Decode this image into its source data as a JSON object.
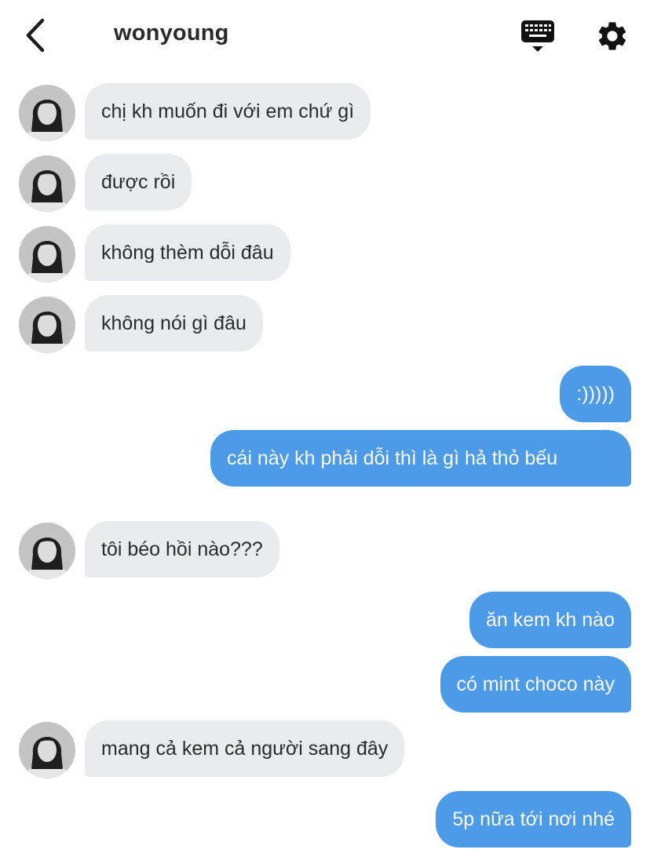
{
  "header": {
    "title": "wonyoung",
    "back_icon": "chevron-left-icon",
    "keyboard_icon": "keyboard-icon",
    "settings_icon": "gear-icon"
  },
  "messages": [
    {
      "direction": "in",
      "text": "chị kh muốn đi với em chứ gì"
    },
    {
      "direction": "in",
      "text": "được rồi"
    },
    {
      "direction": "in",
      "text": "không thèm dỗi đâu"
    },
    {
      "direction": "in",
      "text": "không nói gì đâu"
    },
    {
      "direction": "out",
      "text": ":)))))"
    },
    {
      "direction": "out",
      "text": "cái này kh phải dỗi thì là gì hả thỏ bếu"
    },
    {
      "direction": "in",
      "text": "tôi béo hồi nào???"
    },
    {
      "direction": "out",
      "text": "ăn kem kh nào"
    },
    {
      "direction": "out",
      "text": "có mint choco này"
    },
    {
      "direction": "in",
      "text": "mang cả kem cả người sang đây"
    },
    {
      "direction": "out",
      "text": "5p nữa tới nơi nhé"
    }
  ],
  "colors": {
    "incoming_bubble": "#e9ebee",
    "outgoing_bubble": "#4c9be8",
    "outgoing_text": "#ffffff"
  }
}
